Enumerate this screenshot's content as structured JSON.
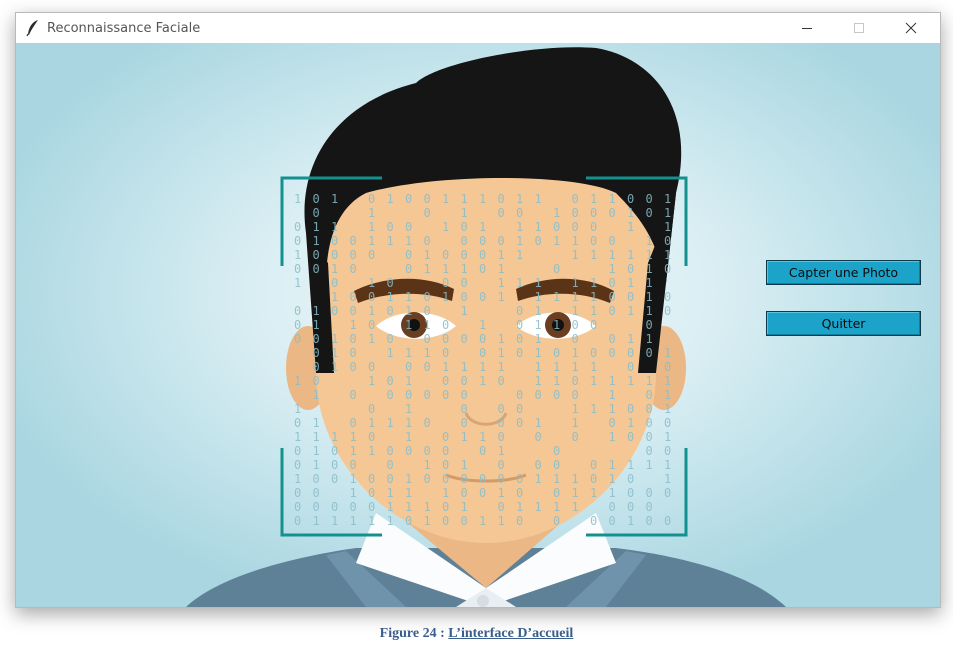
{
  "window": {
    "title": "Reconnaissance Faciale",
    "app_icon": "feather-icon",
    "controls": [
      "minimize-icon",
      "maximize-icon",
      "close-icon"
    ]
  },
  "buttons": {
    "capture_label": "Capter une Photo",
    "quit_label": "Quitter"
  },
  "colors": {
    "button_bg": "#1ba3c9",
    "frame_bracket": "#13918f",
    "caption": "#3a5e8c"
  },
  "caption": {
    "prefix": "Figure 24 : ",
    "text": "L’interface  D’accueil"
  }
}
